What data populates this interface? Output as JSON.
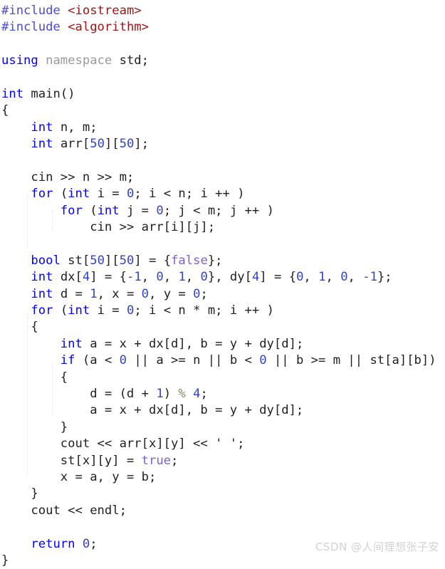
{
  "editor": {
    "background": "#ffffff",
    "font_size_px": 17,
    "language": "cpp"
  },
  "colors": {
    "keyword": "#0000ff",
    "preprocessor": "#4b4bd6",
    "header_name": "#a31515",
    "namespace": "#9a9a9a",
    "number": "#3344cc",
    "bool_literal": "#7b61d6",
    "operator": "#8a8a6a",
    "plain_text": "#1f1f1f",
    "indent_guide": "#e2e2e2",
    "watermark": "#d2d2d2"
  },
  "code": {
    "full_text": "#include <iostream>\n#include <algorithm>\n\nusing namespace std;\n\nint main()\n{\n    int n, m;\n    int arr[50][50];\n\n    cin >> n >> m;\n    for (int i = 0; i < n; i ++ )\n        for (int j = 0; j < m; j ++ )\n            cin >> arr[i][j];\n\n    bool st[50][50] = {false};\n    int dx[4] = {-1, 0, 1, 0}, dy[4] = {0, 1, 0, -1};\n    int d = 1, x = 0, y = 0;\n    for (int i = 0; i < n * m; i ++ )\n    {\n        int a = x + dx[d], b = y + dy[d];\n        if (a < 0 || a >= n || b < 0 || b >= m || st[a][b])\n        {\n            d = (d + 1) % 4;\n            a = x + dx[d], b = y + dy[d];\n        }\n        cout << arr[x][y] << ' ';\n        st[x][y] = true;\n        x = a, y = b;\n    }\n    cout << endl;\n\n    return 0;\n}",
    "lines": [
      "#include <iostream>",
      "#include <algorithm>",
      "",
      "using namespace std;",
      "",
      "int main()",
      "{",
      "    int n, m;",
      "    int arr[50][50];",
      "",
      "    cin >> n >> m;",
      "    for (int i = 0; i < n; i ++ )",
      "        for (int j = 0; j < m; j ++ )",
      "            cin >> arr[i][j];",
      "",
      "    bool st[50][50] = {false};",
      "    int dx[4] = {-1, 0, 1, 0}, dy[4] = {0, 1, 0, -1};",
      "    int d = 1, x = 0, y = 0;",
      "    for (int i = 0; i < n * m; i ++ )",
      "    {",
      "        int a = x + dx[d], b = y + dy[d];",
      "        if (a < 0 || a >= n || b < 0 || b >= m || st[a][b])",
      "        {",
      "            d = (d + 1) % 4;",
      "            a = x + dx[d], b = y + dy[d];",
      "        }",
      "        cout << arr[x][y] << ' ';",
      "        st[x][y] = true;",
      "        x = a, y = b;",
      "    }",
      "    cout << endl;",
      "",
      "    return 0;",
      "}"
    ]
  },
  "watermark": {
    "text": "CSDN @人间理想张子安"
  }
}
